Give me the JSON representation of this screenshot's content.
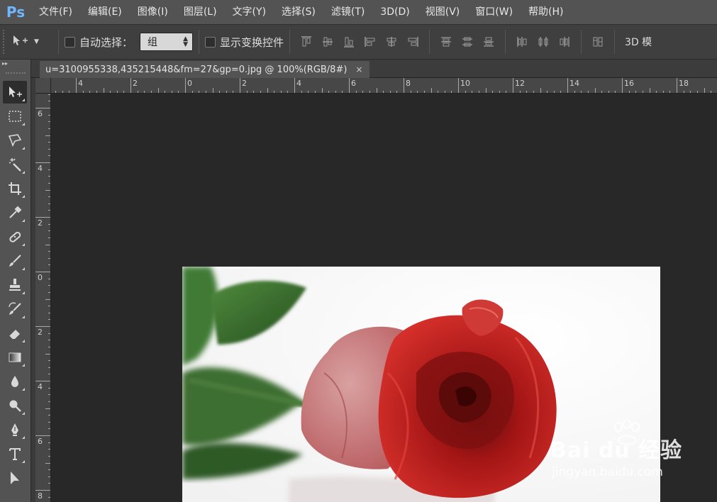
{
  "app": {
    "logo": "Ps"
  },
  "menu": [
    {
      "label": "文件(F)"
    },
    {
      "label": "编辑(E)"
    },
    {
      "label": "图像(I)"
    },
    {
      "label": "图层(L)"
    },
    {
      "label": "文字(Y)"
    },
    {
      "label": "选择(S)"
    },
    {
      "label": "滤镜(T)"
    },
    {
      "label": "3D(D)"
    },
    {
      "label": "视图(V)"
    },
    {
      "label": "窗口(W)"
    },
    {
      "label": "帮助(H)"
    }
  ],
  "options": {
    "auto_select_label": "自动选择：",
    "auto_select_value": "组",
    "show_transform_label": "显示变换控件",
    "mode_3d_label": "3D 模"
  },
  "document": {
    "tab_title": "u=3100955338,435215448&fm=27&gp=0.jpg @ 100%(RGB/8#)",
    "close_glyph": "×"
  },
  "rulers": {
    "horizontal": [
      "4",
      "2",
      "0",
      "2",
      "4",
      "6",
      "8",
      "10",
      "12",
      "14",
      "16",
      "18"
    ],
    "vertical": [
      "6",
      "4",
      "2",
      "0",
      "2",
      "4",
      "6",
      "8"
    ]
  },
  "watermark": {
    "title": "Bai du 经验",
    "subtitle": "jingyan.baidu.com"
  },
  "colors": {
    "menubar": "#535353",
    "optionsbar": "#3f3f3f",
    "canvas_bg": "#282828",
    "logo": "#6fb6ff"
  }
}
